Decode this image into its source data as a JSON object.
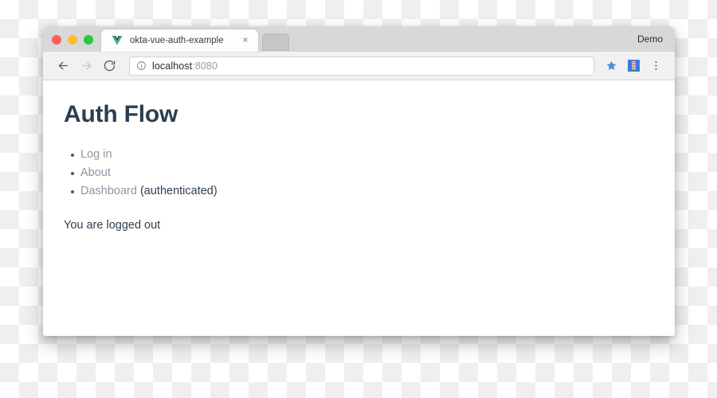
{
  "window": {
    "traffic_lights": [
      {
        "name": "close",
        "color": "#ff5f57"
      },
      {
        "name": "minimize",
        "color": "#febc2e"
      },
      {
        "name": "zoom",
        "color": "#28c840"
      }
    ],
    "profile_label": "Demo"
  },
  "tab": {
    "title": "okta-vue-auth-example",
    "favicon": "vue-logo-icon",
    "close_label": "×",
    "new_tab_label": ""
  },
  "toolbar": {
    "back_icon": "back-arrow-icon",
    "forward_icon": "forward-arrow-icon",
    "reload_icon": "reload-icon",
    "info_icon": "info-circle-icon",
    "url_host": "localhost",
    "url_port": ":8080",
    "bookmark_icon": "star-icon",
    "extension_icon": "extension-icon",
    "menu_icon": "three-dot-menu-icon",
    "accent_color": "#4a90e2"
  },
  "page": {
    "heading": "Auth Flow",
    "links": [
      {
        "label": "Log in",
        "note": ""
      },
      {
        "label": "About",
        "note": ""
      },
      {
        "label": "Dashboard",
        "note": " (authenticated)"
      }
    ],
    "status": "You are logged out",
    "heading_color": "#2c3e50",
    "link_color": "#8d98a3"
  }
}
